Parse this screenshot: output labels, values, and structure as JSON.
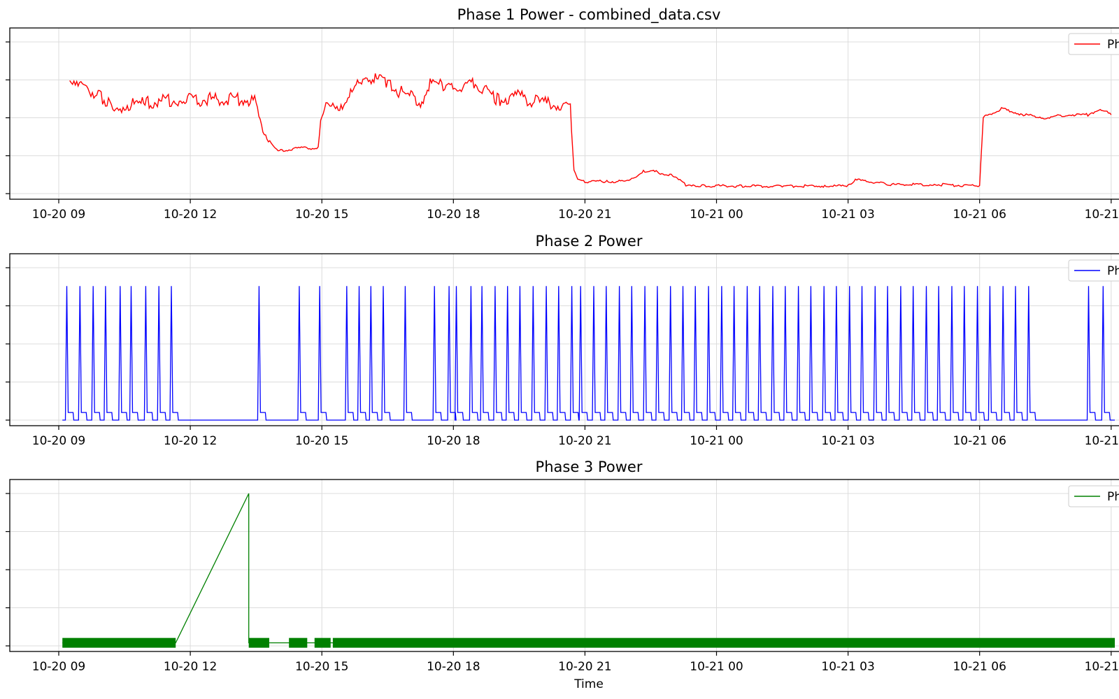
{
  "chart_data": [
    {
      "type": "line",
      "title": "Phase 1 Power - combined_data.csv",
      "xlabel": "",
      "ylabel": "",
      "x_tick_labels": [
        "10-20 09",
        "10-20 12",
        "10-20 15",
        "10-20 18",
        "10-20 21",
        "10-21 00",
        "10-21 03",
        "10-21 06",
        "10-21 09"
      ],
      "xlim": [
        "2023-10-20 08:46",
        "2023-10-21 09:15"
      ],
      "ylim": [
        0,
        100
      ],
      "grid": true,
      "legend": {
        "position": "top-right",
        "entries": [
          "Ph"
        ]
      },
      "color": "#ff0000",
      "series": [
        {
          "x": [
            "2023-10-20 09:15",
            "2023-10-20 09:40",
            "2023-10-20 10:00",
            "2023-10-20 10:10",
            "2023-10-20 10:30",
            "2023-10-20 11:00",
            "2023-10-20 11:45",
            "2023-10-20 13:20",
            "2023-10-20 13:30",
            "2023-10-20 13:45",
            "2023-10-20 14:00",
            "2023-10-20 14:30",
            "2023-10-20 14:55",
            "2023-10-20 15:00",
            "2023-10-20 15:30",
            "2023-10-20 16:00",
            "2023-10-20 16:30",
            "2023-10-20 17:00",
            "2023-10-20 17:15",
            "2023-10-20 17:30",
            "2023-10-20 17:50",
            "2023-10-20 18:30",
            "2023-10-20 19:00",
            "2023-10-20 19:30",
            "2023-10-20 20:00",
            "2023-10-20 20:40",
            "2023-10-20 20:45",
            "2023-10-20 20:50",
            "2023-10-20 21:00",
            "2023-10-20 21:30",
            "2023-10-20 22:00",
            "2023-10-20 22:20",
            "2023-10-20 22:30",
            "2023-10-20 23:00",
            "2023-10-20 23:20",
            "2023-10-20 23:40",
            "2023-10-21 00:30",
            "2023-10-21 01:30",
            "2023-10-21 02:30",
            "2023-10-21 03:00",
            "2023-10-21 03:10",
            "2023-10-21 04:00",
            "2023-10-21 05:00",
            "2023-10-21 06:00",
            "2023-10-21 06:05",
            "2023-10-21 06:30",
            "2023-10-21 07:00",
            "2023-10-21 07:30",
            "2023-10-21 08:00",
            "2023-10-21 08:30",
            "2023-10-21 08:45",
            "2023-10-21 09:00"
          ],
          "y": [
            77,
            70,
            63,
            58,
            58,
            60,
            62,
            62,
            60,
            36,
            28,
            30,
            30,
            55,
            60,
            78,
            72,
            64,
            60,
            74,
            70,
            72,
            62,
            64,
            60,
            56,
            15,
            9,
            8,
            8,
            8,
            15,
            15,
            12,
            5,
            5,
            5,
            5,
            5,
            5,
            9,
            6,
            6,
            5,
            50,
            56,
            52,
            50,
            52,
            52,
            56,
            52
          ]
        }
      ]
    },
    {
      "type": "line",
      "title": "Phase 2 Power",
      "xlabel": "",
      "ylabel": "",
      "x_tick_labels": [
        "10-20 09",
        "10-20 12",
        "10-20 15",
        "10-20 18",
        "10-20 21",
        "10-21 00",
        "10-21 03",
        "10-21 06",
        "10-21 09"
      ],
      "xlim": [
        "2023-10-20 08:46",
        "2023-10-21 09:15"
      ],
      "ylim": [
        0,
        100
      ],
      "grid": true,
      "legend": {
        "position": "top-right",
        "entries": [
          "Ph"
        ]
      },
      "color": "#0000ff",
      "series": [
        {
          "spikes_x": [
            "2023-10-20 09:12",
            "2023-10-20 09:30",
            "2023-10-20 09:48",
            "2023-10-20 10:05",
            "2023-10-20 10:25",
            "2023-10-20 10:40",
            "2023-10-20 11:00",
            "2023-10-20 11:18",
            "2023-10-20 11:35",
            "2023-10-20 13:35",
            "2023-10-20 14:30",
            "2023-10-20 14:58",
            "2023-10-20 15:35",
            "2023-10-20 15:52",
            "2023-10-20 16:08",
            "2023-10-20 16:25",
            "2023-10-20 16:55",
            "2023-10-20 17:35",
            "2023-10-20 17:55",
            "2023-10-20 18:05",
            "2023-10-20 18:25",
            "2023-10-20 18:40",
            "2023-10-20 18:58",
            "2023-10-20 19:15",
            "2023-10-20 19:32",
            "2023-10-20 19:50",
            "2023-10-20 20:08",
            "2023-10-20 20:25",
            "2023-10-20 20:43",
            "2023-10-20 20:55",
            "2023-10-20 21:13",
            "2023-10-20 21:30",
            "2023-10-20 21:48",
            "2023-10-20 22:05",
            "2023-10-20 22:23",
            "2023-10-20 22:40",
            "2023-10-20 22:58",
            "2023-10-20 23:15",
            "2023-10-20 23:32",
            "2023-10-20 23:50",
            "2023-10-21 00:08",
            "2023-10-21 00:25",
            "2023-10-21 00:43",
            "2023-10-21 01:00",
            "2023-10-21 01:18",
            "2023-10-21 01:35",
            "2023-10-21 01:53",
            "2023-10-21 02:10",
            "2023-10-21 02:28",
            "2023-10-21 02:45",
            "2023-10-21 03:03",
            "2023-10-21 03:20",
            "2023-10-21 03:38",
            "2023-10-21 03:55",
            "2023-10-21 04:13",
            "2023-10-21 04:30",
            "2023-10-21 04:48",
            "2023-10-21 05:05",
            "2023-10-21 05:23",
            "2023-10-21 05:40",
            "2023-10-21 05:58",
            "2023-10-21 06:15",
            "2023-10-21 06:33",
            "2023-10-21 06:50",
            "2023-10-21 07:08",
            "2023-10-21 08:30",
            "2023-10-21 08:50"
          ],
          "spike_peak": 88,
          "baseline": 0,
          "plateau": 5
        }
      ]
    },
    {
      "type": "line",
      "title": "Phase 3 Power",
      "xlabel": "Time",
      "ylabel": "",
      "x_tick_labels": [
        "10-20 09",
        "10-20 12",
        "10-20 15",
        "10-20 18",
        "10-20 21",
        "10-21 00",
        "10-21 03",
        "10-21 06",
        "10-21 09"
      ],
      "xlim": [
        "2023-10-20 08:46",
        "2023-10-21 09:15"
      ],
      "ylim": [
        0,
        100
      ],
      "grid": true,
      "legend": {
        "position": "top-right",
        "entries": [
          "Ph"
        ]
      },
      "color": "#008000",
      "series": [
        {
          "x": [
            "2023-10-20 09:05",
            "2023-10-20 11:40",
            "2023-10-20 13:20",
            "2023-10-20 13:20",
            "2023-10-21 09:05"
          ],
          "y": [
            2,
            2,
            100,
            2,
            2
          ],
          "bands": [
            [
              "2023-10-20 09:05",
              "2023-10-20 11:40"
            ],
            [
              "2023-10-20 13:20",
              "2023-10-20 13:48"
            ],
            [
              "2023-10-20 14:15",
              "2023-10-20 14:40"
            ],
            [
              "2023-10-20 14:50",
              "2023-10-20 15:12"
            ],
            [
              "2023-10-20 15:15",
              "2023-10-21 09:05"
            ]
          ]
        }
      ]
    }
  ]
}
